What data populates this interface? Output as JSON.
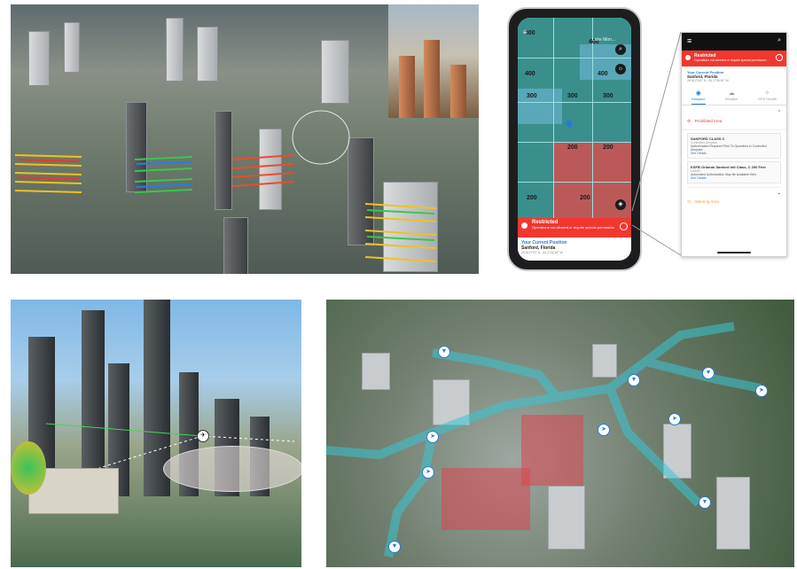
{
  "map": {
    "zones": [
      "400",
      "400",
      "400",
      "400",
      "300",
      "300",
      "300",
      "200",
      "200",
      "200",
      "200"
    ],
    "lake_label": "Lake Mon..."
  },
  "alert": {
    "title": "Restricted",
    "subtitle": "Operations not allowed or require special permission"
  },
  "position": {
    "label": "Your Current Position",
    "city": "Sanford, Florida",
    "coords": "28.812740° N, -81.273016° W"
  },
  "detail": {
    "tabs": [
      "Airspace",
      "Weather",
      "GPS Health"
    ],
    "section": "Prohibited Area",
    "cards": [
      {
        "title": "SANFORD CLASS C",
        "type": "Controlled Airspace",
        "text": "Authorization Required Prior To Operation in Controlled Airspace",
        "link": "See Details"
      },
      {
        "title": "KSFB Orlando Sanford Intl Class, C 200 Feet",
        "type": "LAANC",
        "text": "Automated Authorization May Be Available Here",
        "link": "See Details"
      }
    ],
    "warning": "Warning Area"
  },
  "colors": {
    "restricted": "#f2372f",
    "accent": "#2a7bd0",
    "map": "#3a8f8c"
  }
}
